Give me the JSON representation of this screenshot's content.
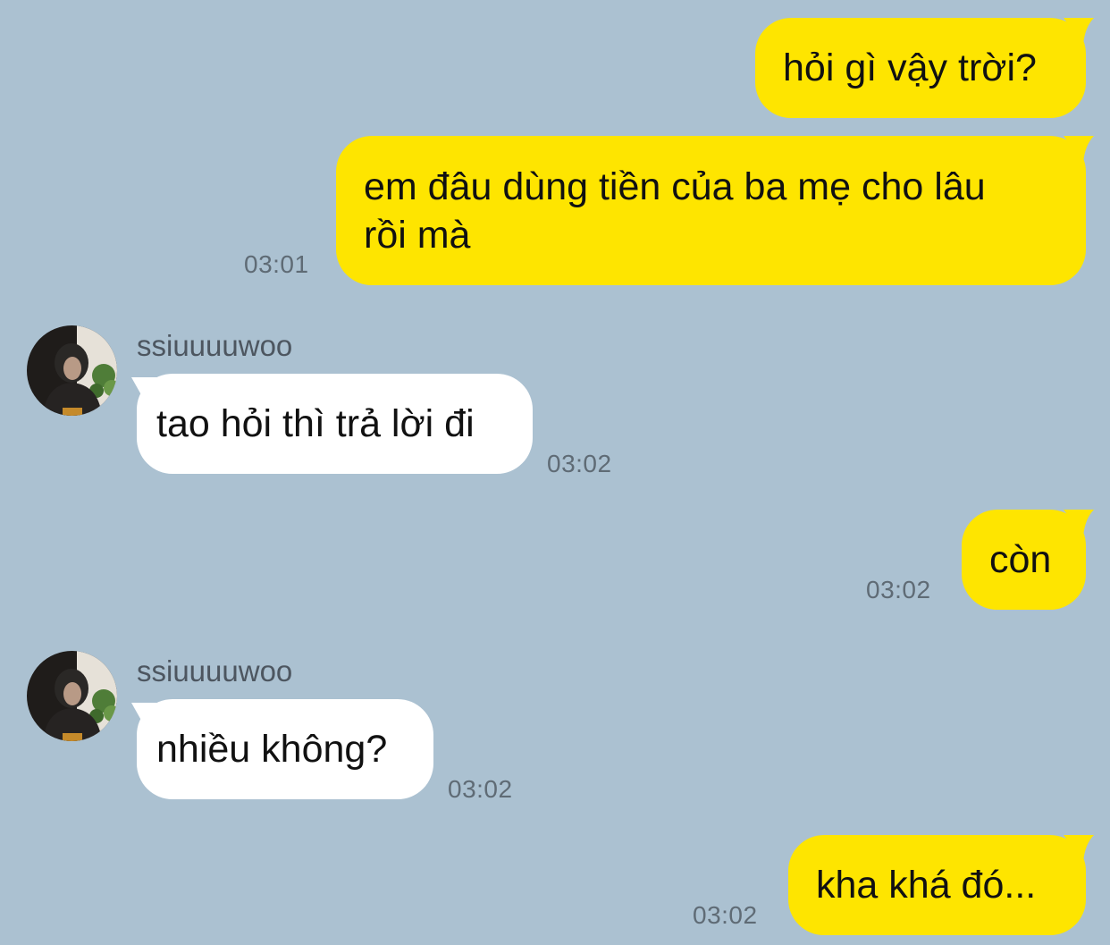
{
  "theme": {
    "background": "#abc1d1",
    "mine_bubble": "#fee500",
    "theirs_bubble": "#ffffff",
    "time_color": "#5f6b75"
  },
  "messages": [
    {
      "direction": "outgoing",
      "text": "hỏi gì vậy trời?",
      "time": ""
    },
    {
      "direction": "outgoing",
      "text": "em đâu dùng tiền của ba mẹ cho lâu\nrồi mà",
      "time": "03:01"
    },
    {
      "direction": "incoming",
      "sender": "ssiuuuuwoo",
      "avatar_icon": "profile-photo",
      "text": "tao hỏi thì trả lời đi",
      "time": "03:02"
    },
    {
      "direction": "outgoing",
      "text": "còn",
      "time": "03:02"
    },
    {
      "direction": "incoming",
      "sender": "ssiuuuuwoo",
      "avatar_icon": "profile-photo",
      "text": "nhiều không?",
      "time": "03:02"
    },
    {
      "direction": "outgoing",
      "text": "kha khá đó...",
      "time": "03:02"
    }
  ]
}
